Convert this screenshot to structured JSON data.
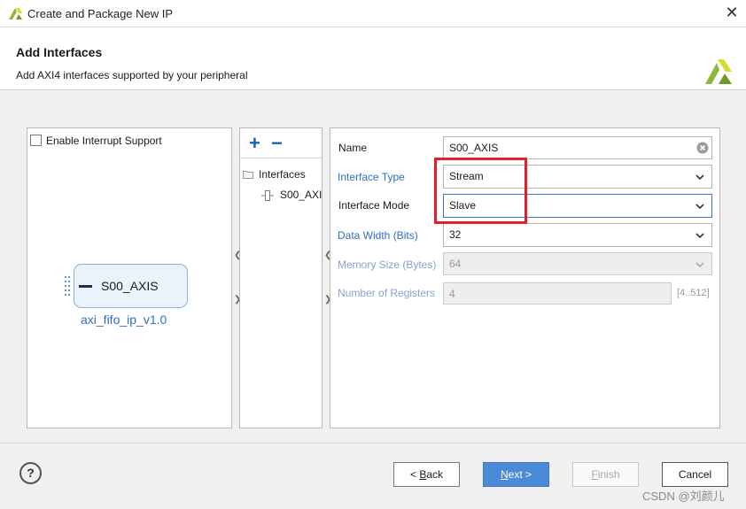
{
  "window": {
    "title": "Create and Package New IP",
    "close_glyph": "✕",
    "logo_icon": "xilinx-logo-icon"
  },
  "header": {
    "title": "Add Interfaces",
    "subtitle": "Add AXI4 interfaces supported by your peripheral"
  },
  "left_panel": {
    "interrupt_label": "Enable Interrupt Support",
    "interrupt_checked": false,
    "port_name": "S00_AXIS",
    "ip_name": "axi_fifo_ip_v1.0"
  },
  "tree": {
    "add_glyph": "+",
    "remove_glyph": "−",
    "root_label": "Interfaces",
    "items": [
      {
        "label": "S00_AXI"
      }
    ]
  },
  "form": {
    "name_label": "Name",
    "name_value": "S00_AXIS",
    "interface_type_label": "Interface Type",
    "interface_type_value": "Stream",
    "interface_mode_label": "Interface Mode",
    "interface_mode_value": "Slave",
    "data_width_label": "Data Width (Bits)",
    "data_width_value": "32",
    "memory_size_label": "Memory Size (Bytes)",
    "memory_size_value": "64",
    "num_registers_label": "Number of Registers",
    "num_registers_value": "4",
    "num_registers_range": "[4..512]"
  },
  "footer": {
    "help_glyph": "?",
    "back_prefix": "< ",
    "back_mnemonic": "B",
    "back_rest": "ack",
    "next_mnemonic": "N",
    "next_rest": "ext >",
    "finish_mnemonic": "F",
    "finish_rest": "inish",
    "cancel_label": "Cancel"
  },
  "watermark": "CSDN @刘颜儿",
  "colors": {
    "accent_blue": "#2f6fbf",
    "primary_button": "#4a8ad6",
    "highlight_red": "#e0202a",
    "logo_green": "#8cb63c",
    "logo_yellow": "#d5dc2c"
  }
}
